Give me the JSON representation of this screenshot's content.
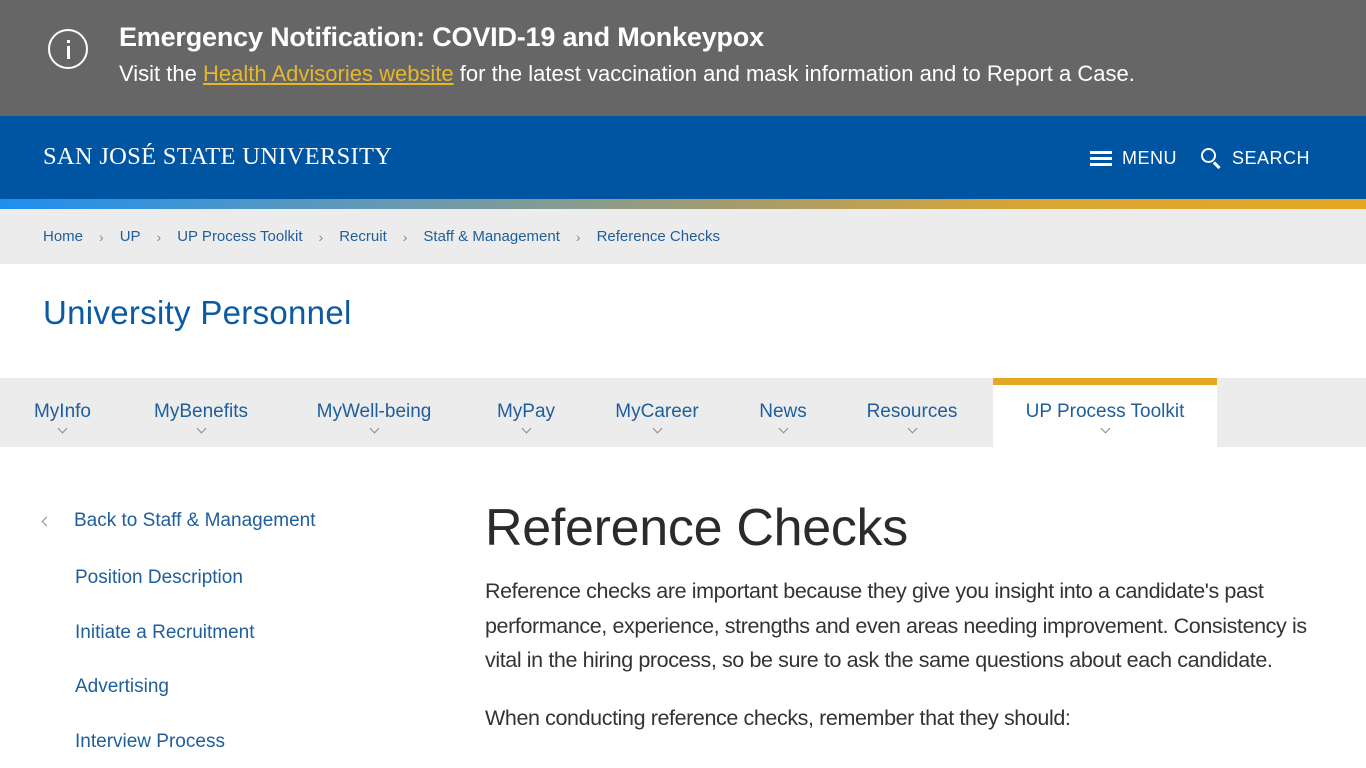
{
  "alert": {
    "icon": "info-icon",
    "title": "Emergency Notification: COVID-19 and Monkeypox",
    "text_before": "Visit the ",
    "link_text": "Health Advisories website",
    "text_after": " for the latest vaccination and mask information and to Report a Case."
  },
  "header": {
    "logo": "SAN JOSÉ STATE UNIVERSITY",
    "menu_label": "MENU",
    "search_label": "SEARCH",
    "colors": {
      "header_bg": "#0055a2",
      "accent_gold": "#e5a823",
      "alert_bg": "#666666"
    }
  },
  "breadcrumb": {
    "items": [
      "Home",
      "UP",
      "UP Process Toolkit",
      "Recruit",
      "Staff & Management",
      "Reference Checks"
    ],
    "separator": "›"
  },
  "section": {
    "title": "University Personnel"
  },
  "nav": {
    "items": [
      {
        "label": "MyInfo",
        "active": false
      },
      {
        "label": "MyBenefits",
        "active": false
      },
      {
        "label": "MyWell-being",
        "active": false
      },
      {
        "label": "MyPay",
        "active": false
      },
      {
        "label": "MyCareer",
        "active": false
      },
      {
        "label": "News",
        "active": false
      },
      {
        "label": "Resources",
        "active": false
      },
      {
        "label": "UP Process Toolkit",
        "active": true
      }
    ]
  },
  "sidebar": {
    "back_label": "Back to Staff & Management",
    "items": [
      "Position Description",
      "Initiate a Recruitment",
      "Advertising",
      "Interview Process"
    ]
  },
  "main": {
    "title": "Reference Checks",
    "paragraph1": "Reference checks are important because they give you insight into a candidate's past performance, experience, strengths and even areas needing improvement. Consistency is vital in the hiring process, so be sure to ask the same questions about each candidate.",
    "paragraph2": "When conducting reference checks, remember that they should:"
  }
}
